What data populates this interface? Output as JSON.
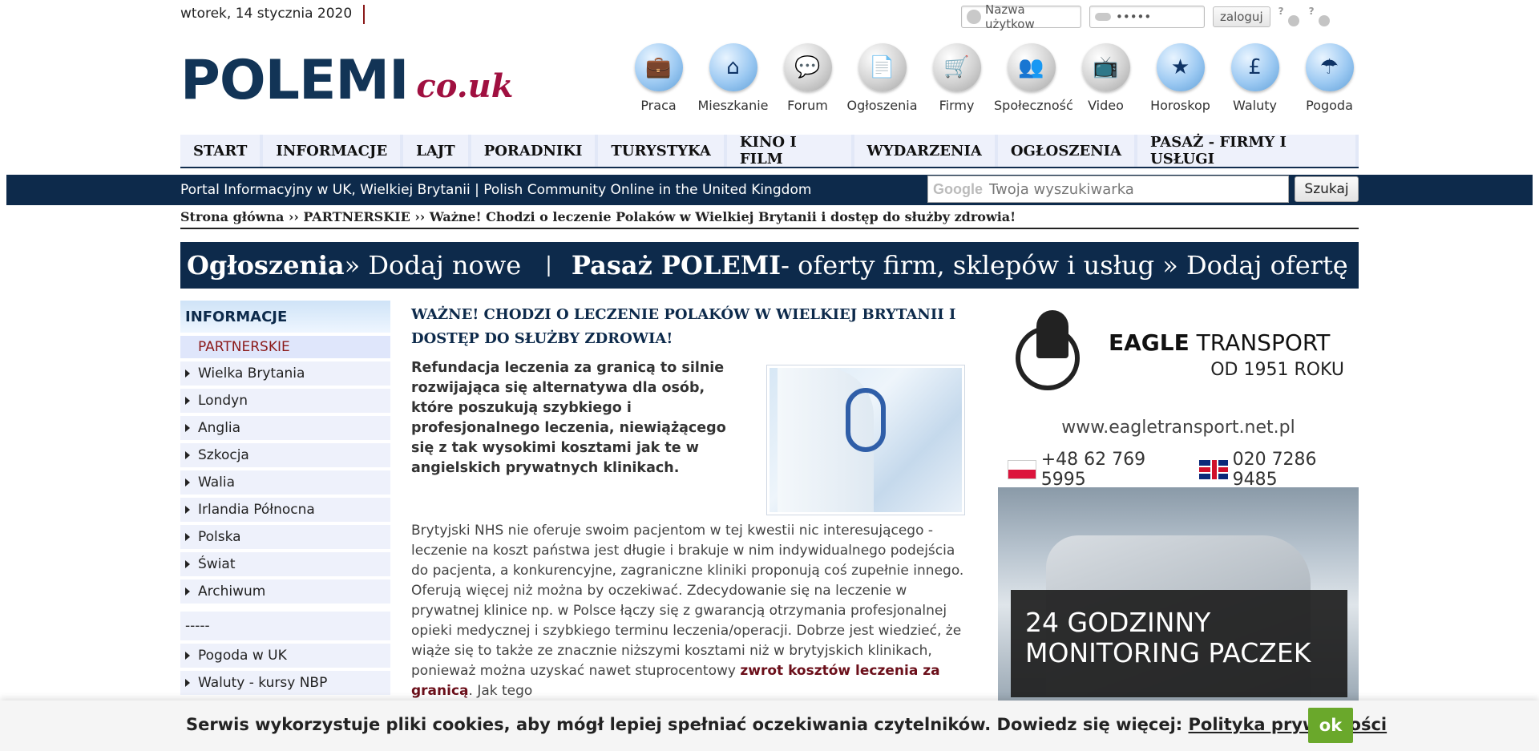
{
  "top": {
    "date": "wtorek, 14 stycznia 2020",
    "username_placeholder": "Nazwa użytkow",
    "password_value": "•••••",
    "login_label": "zaloguj",
    "help_label": "?"
  },
  "logo": {
    "main": "POLEMI",
    "tld": "co.uk"
  },
  "nav_icons": [
    {
      "label": "Praca",
      "icon": "briefcase-icon",
      "glyph": "💼",
      "style": "blue"
    },
    {
      "label": "Mieszkanie",
      "icon": "house-icon",
      "glyph": "⌂",
      "style": "blue"
    },
    {
      "label": "Forum",
      "icon": "speech-bubble-icon",
      "glyph": "💬",
      "style": "grey"
    },
    {
      "label": "Ogłoszenia",
      "icon": "document-add-icon",
      "glyph": "📄",
      "style": "grey"
    },
    {
      "label": "Firmy",
      "icon": "cart-icon",
      "glyph": "🛒",
      "style": "grey"
    },
    {
      "label": "Społeczność",
      "icon": "people-icon",
      "glyph": "👥",
      "style": "grey"
    },
    {
      "label": "Video",
      "icon": "tv-icon",
      "glyph": "📺",
      "style": "grey"
    },
    {
      "label": "Horoskop",
      "icon": "star-icon",
      "glyph": "★",
      "style": "blue"
    },
    {
      "label": "Waluty",
      "icon": "pound-icon",
      "glyph": "£",
      "style": "blue"
    },
    {
      "label": "Pogoda",
      "icon": "umbrella-icon",
      "glyph": "☂",
      "style": "blue"
    }
  ],
  "menu": [
    "START",
    "INFORMACJE",
    "LAJT",
    "PORADNIKI",
    "TURYSTYKA",
    "KINO I FILM",
    "WYDARZENIA",
    "OGŁOSZENIA",
    "PASAŻ - FIRMY I USŁUGI"
  ],
  "band": {
    "tagline": "Portal Informacyjny w UK, Wielkiej Brytanii | Polish Community Online in the United Kingdom",
    "search_brand": "Google",
    "search_placeholder": "Twoja wyszukiwarka",
    "search_button": "Szukaj"
  },
  "breadcrumb": "Strona główna ›› PARTNERSKIE ›› Ważne! Chodzi o leczenie Polaków w Wielkiej Brytanii i dostęp do służby zdrowia!",
  "promo": {
    "left_bold": "Ogłoszenia",
    "left_rest": " » Dodaj nowe",
    "separator": "|",
    "right_bold": "Pasaż POLEMI",
    "right_rest": " - oferty firm, sklepów i usług » Dodaj ofertę"
  },
  "sidebar": {
    "heading": "INFORMACJE",
    "current": "PARTNERSKIE",
    "items": [
      "Wielka Brytania",
      "Londyn",
      "Anglia",
      "Szkocja",
      "Walia",
      "Irlandia Północna",
      "Polska",
      "Świat",
      "Archiwum"
    ],
    "divider": "-----",
    "extra": [
      "Pogoda w UK",
      "Waluty - kursy NBP"
    ]
  },
  "article": {
    "title": "WAŻNE! CHODZI O LECZENIE POLAKÓW W WIELKIEJ BRYTANII I DOSTĘP DO SŁUŻBY ZDROWIA!",
    "lead": "Refundacja leczenia za granicą to silnie rozwijająca się alternatywa dla osób, które poszukują szybkiego i profesjonalnego leczenia, niewiążącego się z tak wysokimi kosztami jak te w angielskich prywatnych klinikach.",
    "body_before": "Brytyjski NHS nie oferuje swoim pacjentom w tej kwestii nic interesującego - leczenie na koszt państwa jest długie i brakuje w nim indywidualnego podejścia do pacjenta, a konkurencyjne, zagraniczne kliniki proponują coś zupełnie innego. Oferują więcej niż można by oczekiwać. Zdecydowanie się na leczenie w prywatnej klinice np. w Polsce łączy się z gwarancją otrzymania profesjonalnej opieki medycznej i szybkiego terminu leczenia/operacji. Dobrze jest wiedzieć, że wiąże się to także ze znacznie niższymi kosztami niż w brytyjskich klinikach, ponieważ można uzyskać nawet stuprocentowy ",
    "body_link": "zwrot kosztów leczenia za granicą",
    "body_after": ". Jak tego"
  },
  "ad": {
    "brand_bold": "EAGLE",
    "brand_rest": " TRANSPORT",
    "since": "OD 1951 ROKU",
    "url": "www.eagletransport.net.pl",
    "phone_pl": "+48 62 769 5995",
    "phone_uk": "020 7286 9485",
    "monitoring_line1": "24 GODZINNY",
    "monitoring_line2": "MONITORING PACZEK"
  },
  "cookie": {
    "message": "Serwis wykorzystuje pliki cookies, aby mógł lepiej spełniać oczekiwania czytelników. Dowiedz się więcej: ",
    "link": "Polityka prywatności",
    "ok": "ok"
  }
}
